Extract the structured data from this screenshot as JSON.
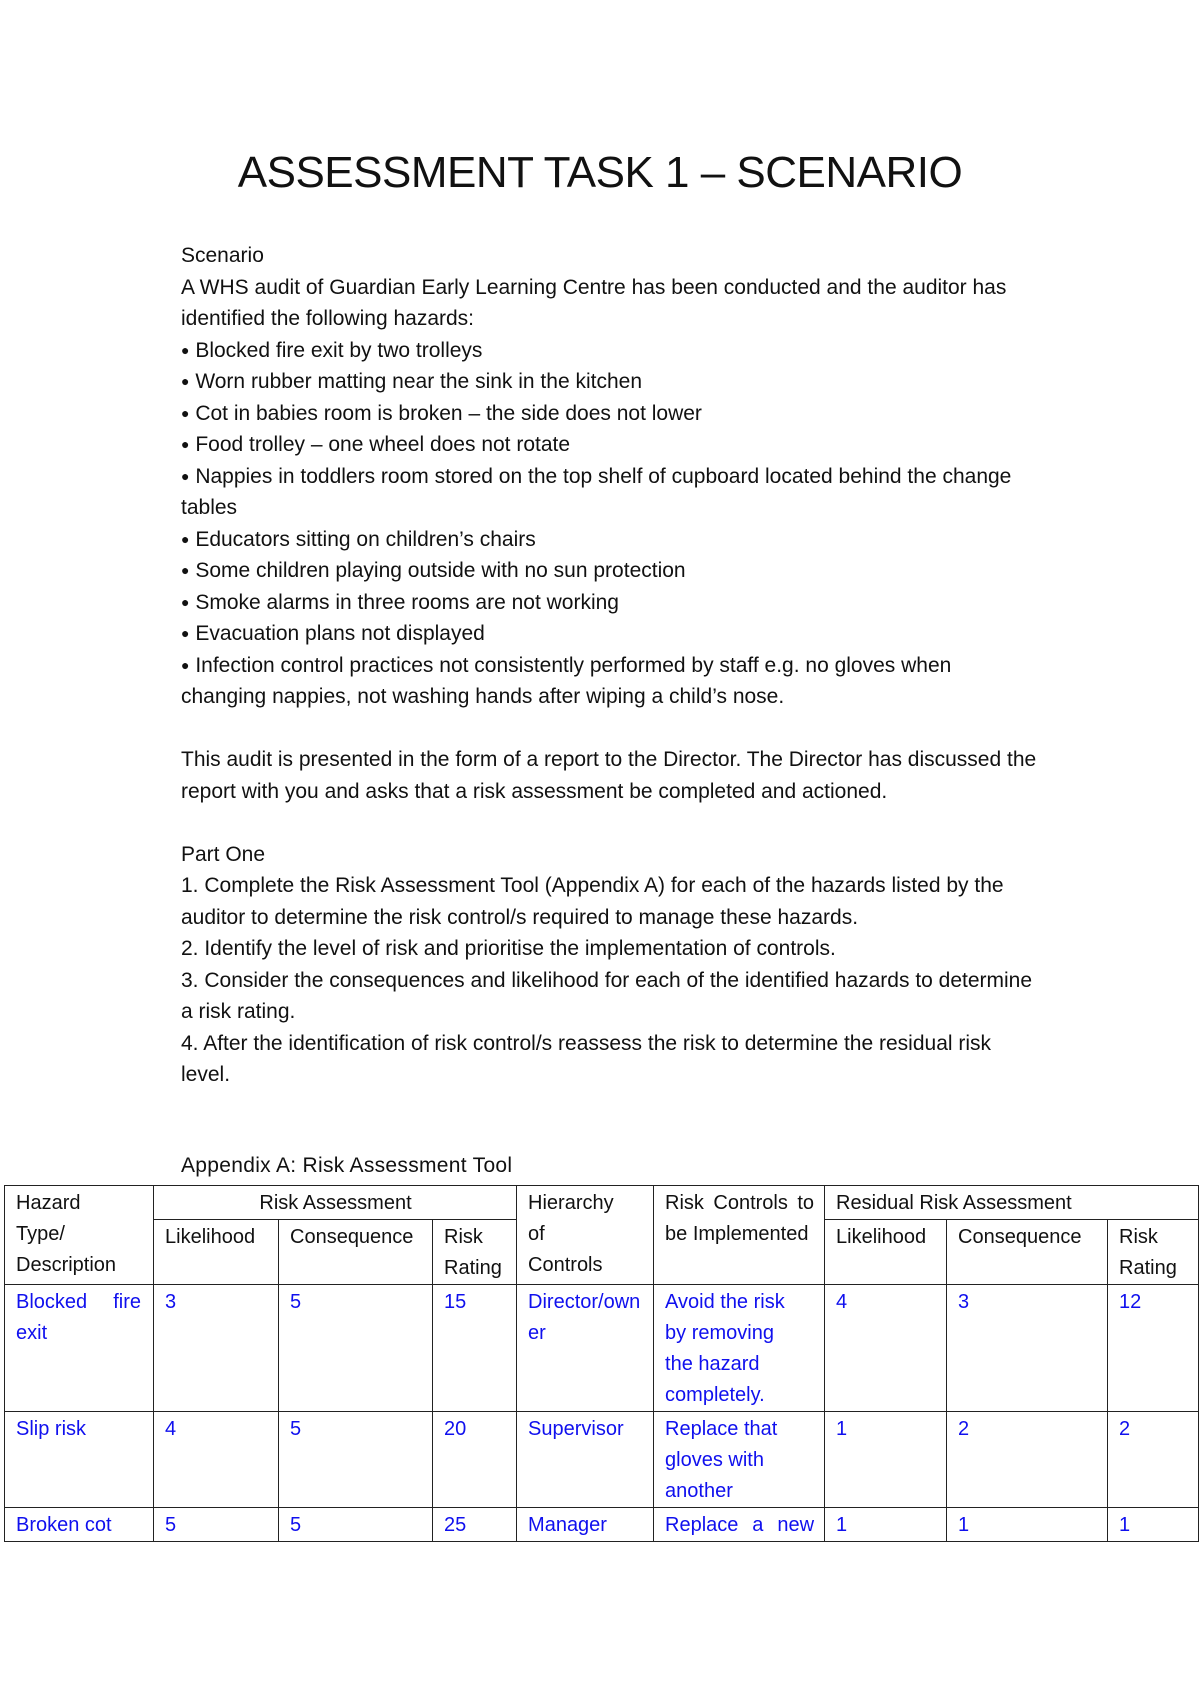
{
  "document": {
    "title": "ASSESSMENT TASK 1 – SCENARIO",
    "scenario_heading": "Scenario",
    "intro": "A WHS audit of Guardian Early Learning Centre has been conducted and the auditor has identified the following hazards:",
    "bullet_glyph": "●",
    "hazards": [
      "Blocked fire exit by two trolleys",
      "Worn rubber matting near the sink in the kitchen",
      "Cot in babies room is broken – the side does not lower",
      "Food trolley – one wheel does not rotate",
      "Nappies in toddlers room stored on the top shelf of cupboard located behind the change tables",
      "Educators sitting on children’s chairs",
      "Some children playing outside with no sun protection",
      "Smoke alarms in three rooms are not working",
      "Evacuation plans not displayed",
      "Infection control practices not consistently performed by staff e.g. no gloves when changing nappies, not washing hands after wiping a child’s nose."
    ],
    "report_paragraph": "This audit is presented in the form of a report to the Director. The Director has discussed the report with you and asks that a risk assessment be completed and actioned.",
    "part_one_heading": "Part One",
    "part_one_steps": [
      "1. Complete the Risk Assessment Tool (Appendix A) for each of the hazards listed by the auditor to determine the risk control/s required to manage these hazards.",
      "2. Identify the level of risk and prioritise the implementation of controls.",
      "3. Consider the consequences and likelihood for each of the identified hazards to determine a risk rating.",
      "4. After the identification of risk control/s reassess the risk to determine the residual risk level."
    ],
    "appendix_label": "Appendix A: Risk Assessment Tool"
  },
  "table": {
    "headers": {
      "hazard": "Hazard Type/ Description",
      "risk_assessment": "Risk Assessment",
      "hierarchy": "Hierarchy of Controls",
      "controls": "Risk Controls to be Implemented",
      "residual": "Residual Risk Assessment",
      "likelihood": "Likelihood",
      "consequence": "Consequence",
      "risk_rating": "Risk Rating"
    },
    "rows": [
      {
        "hazard": "Blocked fire exit",
        "likelihood": "3",
        "consequence": "5",
        "rating": "15",
        "hierarchy": "Director/owner",
        "controls": "Avoid the risk by removing the hazard completely.",
        "res_likelihood": "4",
        "res_consequence": "3",
        "res_rating": "12"
      },
      {
        "hazard": "Slip risk",
        "likelihood": "4",
        "consequence": "5",
        "rating": "20",
        "hierarchy": "Supervisor",
        "controls": "Replace that gloves with another",
        "res_likelihood": "1",
        "res_consequence": "2",
        "res_rating": "2"
      },
      {
        "hazard": "Broken cot",
        "likelihood": "5",
        "consequence": "5",
        "rating": "25",
        "hierarchy": "Manager",
        "controls": "Replace a new",
        "res_likelihood": "1",
        "res_consequence": "1",
        "res_rating": "1"
      }
    ],
    "entry_color": "#1010ee"
  }
}
